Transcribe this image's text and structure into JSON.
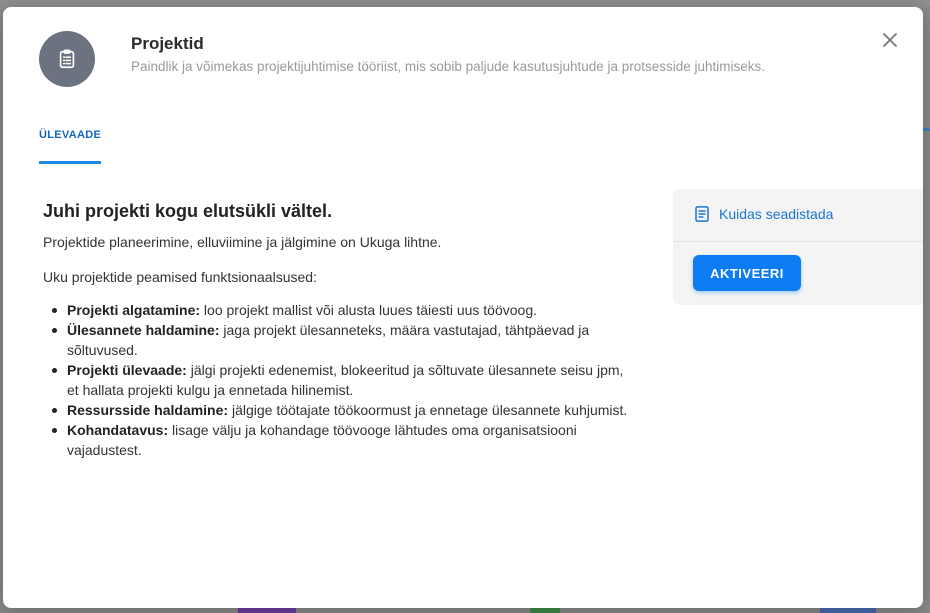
{
  "modal": {
    "title": "Projektid",
    "subtitle": "Paindlik ja võimekas projektijuhtimise tööriist, mis sobib paljude kasutusjuhtude ja protsesside juhtimiseks.",
    "app_icon": "clipboard-icon",
    "close_icon": "close-icon"
  },
  "tabs": [
    {
      "label": "ÜLEVAADE",
      "active": true
    }
  ],
  "content": {
    "heading": "Juhi projekti kogu elutsükli vältel.",
    "intro": "Projektide planeerimine, elluviimine ja jälgimine on Ukuga lihtne.",
    "lead": "Uku projektide peamised funktsionaalsused:",
    "features": [
      {
        "name": "Projekti algatamine:",
        "text": " loo projekt mallist või alusta luues täiesti uus töövoog."
      },
      {
        "name": "Ülesannete haldamine:",
        "text": " jaga projekt ülesanneteks, määra vastutajad, tähtpäevad ja sõltuvused."
      },
      {
        "name": "Projekti ülevaade:",
        "text": " jälgi projekti edenemist, blokeeritud ja sõltuvate ülesannete seisu jpm, et hallata projekti kulgu ja ennetada hilinemist."
      },
      {
        "name": "Ressursside haldamine:",
        "text": " jälgige töötajate töökoormust ja ennetage ülesannete kuhjumist."
      },
      {
        "name": "Kohandatavus:",
        "text": " lisage välju ja kohandage töövooge lähtudes oma organisatsiooni vajadustest."
      }
    ]
  },
  "side_panel": {
    "setup_link": "Kuidas seadistada",
    "setup_icon": "document-icon",
    "activate_label": "AKTIVEERI"
  },
  "colors": {
    "accent": "#0d7cf2",
    "link": "#1976d2",
    "icon_bg": "#6b7280"
  }
}
